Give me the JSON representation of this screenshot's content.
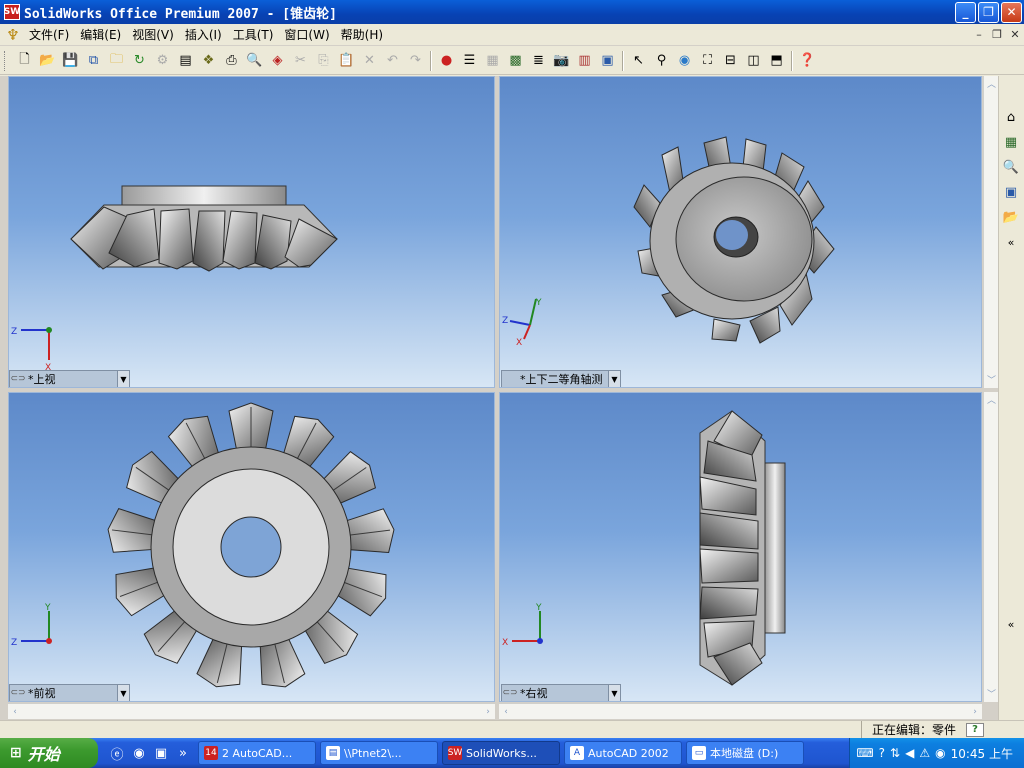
{
  "window": {
    "title": "SolidWorks Office Premium 2007 - [锥齿轮]",
    "app_icon": "SW"
  },
  "menu": {
    "items": [
      "文件(F)",
      "编辑(E)",
      "视图(V)",
      "插入(I)",
      "工具(T)",
      "窗口(W)",
      "帮助(H)"
    ]
  },
  "toolbar": {
    "buttons": [
      "new-icon",
      "open-icon",
      "save-icon",
      "save-all-icon",
      "open-folder-icon",
      "rebuild-icon",
      "options-icon",
      "properties-icon",
      "print-preview-icon",
      "print-icon",
      "find-icon",
      "3dcontent-icon",
      "cut-icon",
      "copy-icon",
      "paste-icon",
      "delete-icon",
      "undo-icon",
      "redo-icon",
      "traffic-light-icon",
      "notes-icon",
      "library-icon",
      "grid-icon",
      "list-icon",
      "camera-icon",
      "wall-icon",
      "view-icon",
      "select-icon",
      "filter-icon",
      "globe-icon",
      "fit-icon",
      "layout-icon",
      "split-icon",
      "doc-icon",
      "help-icon"
    ]
  },
  "viewports": [
    {
      "label": "*上视",
      "axes": {
        "h": "Z",
        "v": "X"
      }
    },
    {
      "label": "*上下二等角轴测",
      "axes": {
        "h": "Z",
        "v": "Y",
        "d": "X"
      }
    },
    {
      "label": "*前视",
      "axes": {
        "h": "Z",
        "v": "Y"
      }
    },
    {
      "label": "*右视",
      "axes": {
        "h": "X",
        "v": "Y"
      }
    }
  ],
  "status": {
    "editing": "正在编辑：零件",
    "help": "?"
  },
  "taskbar": {
    "start": "开始",
    "tasks": [
      {
        "icon": "14",
        "label": "2 AutoCAD..."
      },
      {
        "icon": "",
        "label": "\\\\Ptnet2\\..."
      },
      {
        "icon": "SW",
        "label": "SolidWorks..."
      },
      {
        "icon": "A",
        "label": "AutoCAD 2002"
      },
      {
        "icon": "",
        "label": "本地磁盘 (D:)"
      }
    ],
    "clock": "10:45 上午"
  },
  "colors": {
    "viewport_top": "#5d89c9",
    "viewport_bottom": "#d7e6f5",
    "gear_light": "#e6e6e6",
    "gear_dark": "#4a4a4a"
  }
}
